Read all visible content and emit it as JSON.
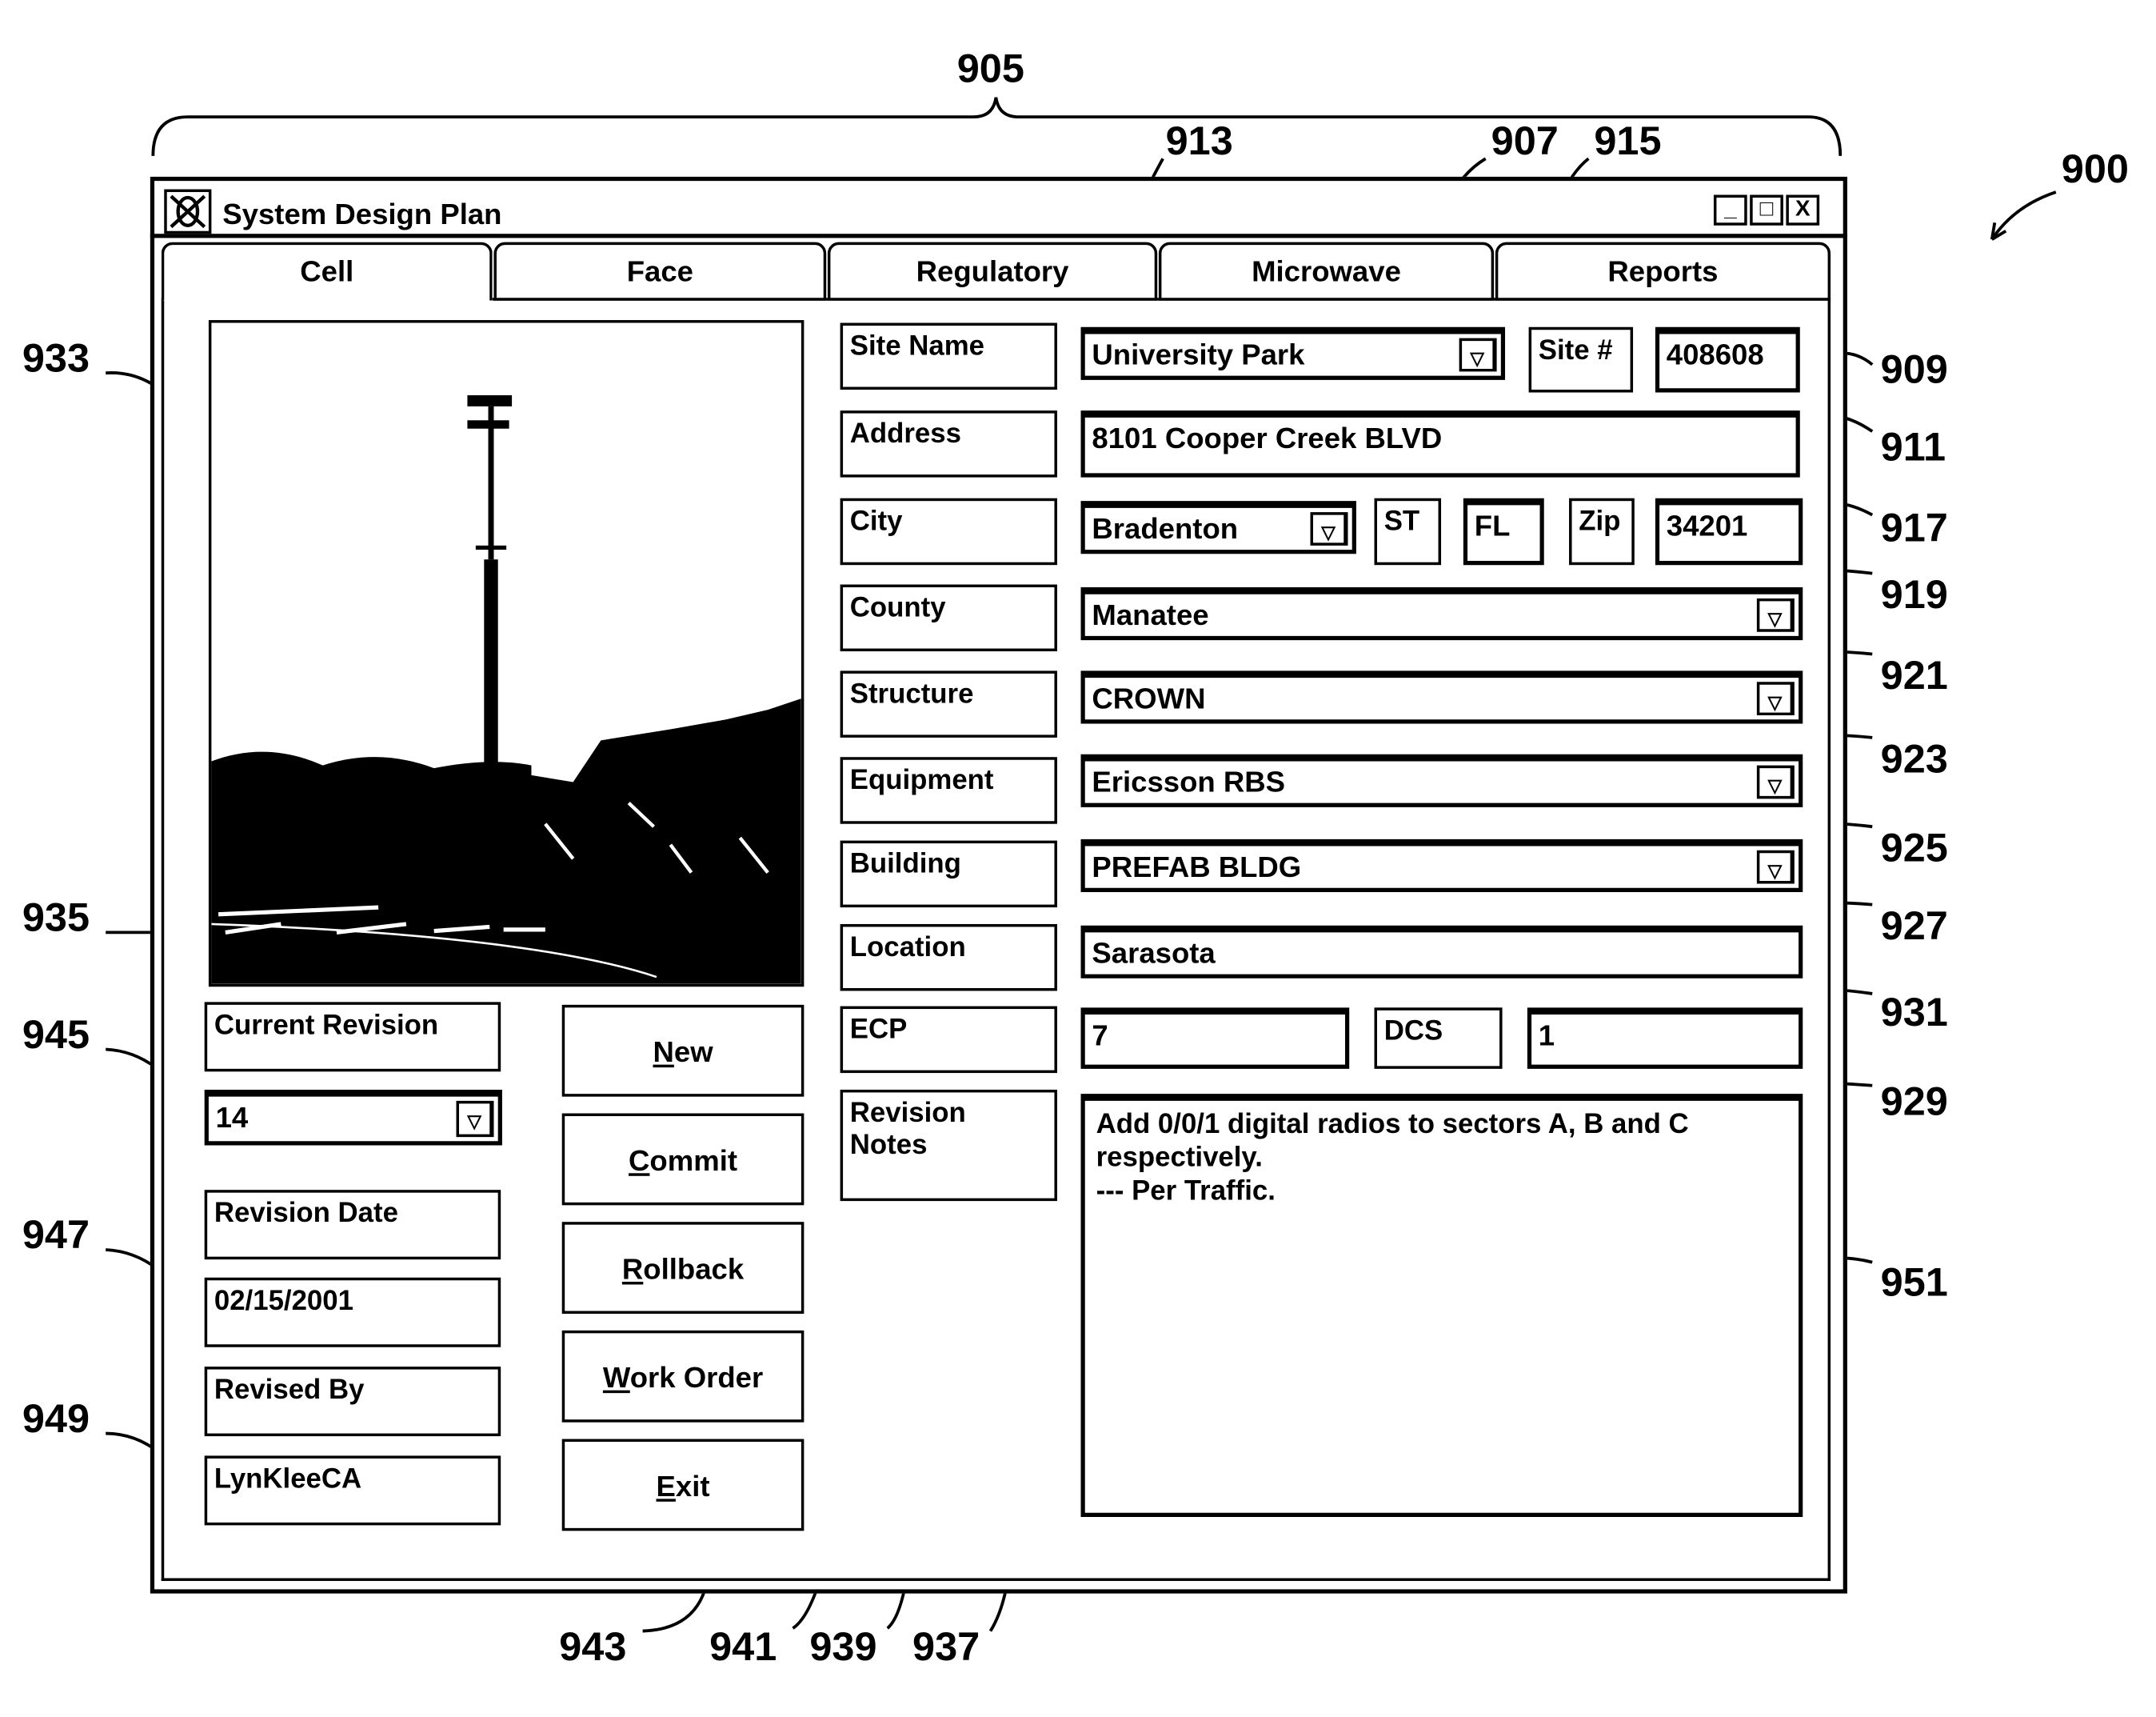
{
  "figure_ref": "900",
  "window_ref": "905",
  "window": {
    "title": "System Design Plan",
    "controls": {
      "minimize": "_",
      "maximize": "□",
      "close": "X"
    }
  },
  "tabs": [
    {
      "label": "Cell",
      "active": true
    },
    {
      "label": "Face",
      "active": false
    },
    {
      "label": "Regulatory",
      "active": false
    },
    {
      "label": "Microwave",
      "active": false
    },
    {
      "label": "Reports",
      "active": false
    }
  ],
  "photo": {
    "description": "cell tower among trees",
    "ref": "933"
  },
  "revision": {
    "current_revision_label": "Current Revision",
    "current_revision_value": "14",
    "revision_date_label": "Revision Date",
    "revision_date_value": "02/15/2001",
    "revised_by_label": "Revised By",
    "revised_by_value": "LynKleeCA"
  },
  "buttons": [
    {
      "mnemonic": "N",
      "rest": "ew",
      "ref": "935"
    },
    {
      "mnemonic": "C",
      "rest": "ommit",
      "ref": "937"
    },
    {
      "mnemonic": "R",
      "rest": "ollback",
      "ref": "939"
    },
    {
      "mnemonic": "W",
      "rest": "ork Order",
      "ref": "941"
    },
    {
      "mnemonic": "E",
      "rest": "xit",
      "ref": "943"
    }
  ],
  "form": {
    "site_name_label": "Site Name",
    "site_name_value": "University Park",
    "site_num_label": "Site #",
    "site_num_value": "408608",
    "address_label": "Address",
    "address_value": "8101 Cooper Creek BLVD",
    "city_label": "City",
    "city_value": "Bradenton",
    "state_label": "ST",
    "state_value": "FL",
    "zip_label": "Zip",
    "zip_value": "34201",
    "county_label": "County",
    "county_value": "Manatee",
    "structure_label": "Structure",
    "structure_value": "CROWN",
    "equipment_label": "Equipment",
    "equipment_value": "Ericsson RBS",
    "building_label": "Building",
    "building_value": "PREFAB BLDG",
    "location_label": "Location",
    "location_value": "Sarasota",
    "ecp_label": "ECP",
    "ecp_value": "7",
    "dcs_label": "DCS",
    "dcs_value": "1",
    "notes_label": "Revision\nNotes",
    "notes_value": "Add 0/0/1 digital radios to sectors A, B and C\nrespectively.\n--- Per Traffic."
  },
  "dropdown_glyph": "▽",
  "refs": {
    "r907": "907",
    "r909": "909",
    "r911": "911",
    "r913": "913",
    "r915": "915",
    "r917": "917",
    "r919": "919",
    "r921": "921",
    "r923": "923",
    "r925": "925",
    "r927": "927",
    "r929": "929",
    "r931": "931",
    "r933": "933",
    "r935": "935",
    "r937": "937",
    "r939": "939",
    "r941": "941",
    "r943": "943",
    "r945": "945",
    "r947": "947",
    "r949": "949",
    "r951": "951"
  }
}
